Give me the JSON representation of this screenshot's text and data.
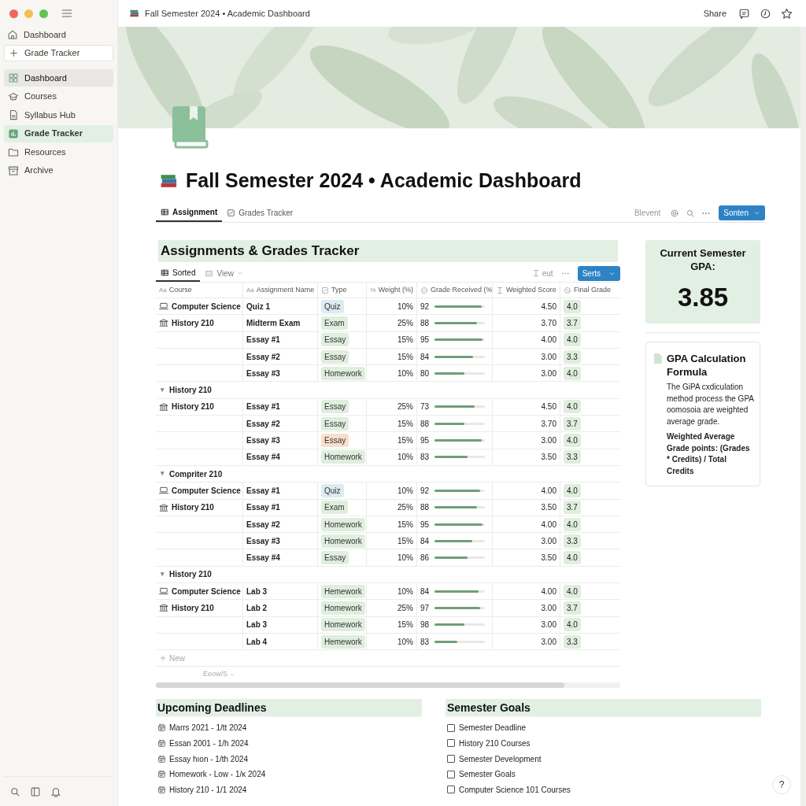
{
  "sidebar": {
    "top_items": [
      {
        "label": "Dashboard"
      }
    ],
    "new_button": {
      "label": "Grade Tracker"
    },
    "nav": [
      {
        "label": "Dashboard",
        "selected": false,
        "hovered": true
      },
      {
        "label": "Courses",
        "selected": false,
        "hovered": false
      },
      {
        "label": "Syllabus Hub",
        "selected": false,
        "hovered": false
      },
      {
        "label": "Grade Tracker",
        "selected": true,
        "hovered": false
      },
      {
        "label": "Resources",
        "selected": false,
        "hovered": false
      },
      {
        "label": "Archive",
        "selected": false,
        "hovered": false
      }
    ]
  },
  "topbar": {
    "title": "Fall Semester 2024 • Academic Dashboard",
    "share": "Share"
  },
  "page": {
    "title": "Fall Semester 2024 • Academic Dashboard",
    "tabs": [
      {
        "label": "Assignment",
        "selected": true
      },
      {
        "label": "Grades Tracker",
        "selected": false
      }
    ],
    "toolbar": {
      "label": "Blevent",
      "button": "Sonten"
    }
  },
  "table": {
    "title": "Assignments & Grades Tracker",
    "views": [
      {
        "label": "Sorted",
        "selected": true
      },
      {
        "label": "View",
        "selected": false
      }
    ],
    "toolbar": {
      "label": "eut",
      "button": "Serts"
    },
    "columns": [
      {
        "label": "Course",
        "prefix": "Aa"
      },
      {
        "label": "Assignment Name",
        "prefix": "Aa"
      },
      {
        "label": "Type"
      },
      {
        "label": "Weight (%)",
        "prefix": "%"
      },
      {
        "label": "Grade Received (%"
      },
      {
        "label": "Weighted Score"
      },
      {
        "label": "Final Grade"
      }
    ],
    "rows": [
      {
        "kind": "row",
        "course": "Computer Science",
        "name": "Quiz 1",
        "type": {
          "label": "Quiz",
          "color": "#dcebf1"
        },
        "weight": "10%",
        "grade": "92",
        "level": 0.93,
        "score": "4.50",
        "final": "4.0"
      },
      {
        "kind": "row",
        "course": "History 210",
        "name": "Midterm Exam",
        "type": {
          "label": "Exam",
          "color": "#dfeedd"
        },
        "weight": "25%",
        "grade": "88",
        "level": 0.85,
        "score": "3.70",
        "final": "3.7"
      },
      {
        "kind": "row",
        "name": "Essay #1",
        "type": {
          "label": "Essay",
          "color": "#dfeedd"
        },
        "weight": "15%",
        "grade": "95",
        "level": 0.96,
        "score": "4.00",
        "final": "4.0"
      },
      {
        "kind": "row",
        "name": "Essay #2",
        "type": {
          "label": "Essay",
          "color": "#dfeedd"
        },
        "weight": "15%",
        "grade": "84",
        "level": 0.76,
        "score": "3.00",
        "final": "3.3"
      },
      {
        "kind": "row",
        "name": "Essay #3",
        "type": {
          "label": "Homework",
          "color": "#dfeedd"
        },
        "weight": "10%",
        "grade": "80",
        "level": 0.6,
        "score": "3.00",
        "final": "4.0"
      },
      {
        "kind": "group",
        "toggle": "▾",
        "label": "History 210"
      },
      {
        "kind": "row",
        "course": "History 210",
        "name": "Essay #1",
        "type": {
          "label": "Essay",
          "color": "#dfeedd"
        },
        "weight": "25%",
        "grade": "73",
        "level": 0.8,
        "score": "4.50",
        "final": "4.0"
      },
      {
        "kind": "row",
        "name": "Essay #2",
        "type": {
          "label": "Essay",
          "color": "#dfeedd"
        },
        "weight": "15%",
        "grade": "88",
        "level": 0.6,
        "score": "3.70",
        "final": "3.7"
      },
      {
        "kind": "row",
        "name": "Essay #3",
        "type": {
          "label": "Essay",
          "color": "#f8dfcc"
        },
        "weight": "15%",
        "grade": "95",
        "level": 0.94,
        "score": "3.00",
        "final": "4.0"
      },
      {
        "kind": "row",
        "name": "Essay #4",
        "type": {
          "label": "Homework",
          "color": "#dfeedd"
        },
        "weight": "10%",
        "grade": "83",
        "level": 0.65,
        "score": "3.50",
        "final": "3.3"
      },
      {
        "kind": "group",
        "toggle": "▾",
        "label": "Compriter 210"
      },
      {
        "kind": "row",
        "course": "Computer Science",
        "name": "Essay #1",
        "type": {
          "label": "Quiz",
          "color": "#dcebf1"
        },
        "weight": "10%",
        "grade": "92",
        "level": 0.9,
        "score": "4.00",
        "final": "4.0"
      },
      {
        "kind": "row",
        "course": "History 210",
        "name": "Essay #1",
        "type": {
          "label": "Exam",
          "color": "#dfeedd"
        },
        "weight": "25%",
        "grade": "88",
        "level": 0.85,
        "score": "3.50",
        "final": "3.7"
      },
      {
        "kind": "row",
        "name": "Essay #2",
        "type": {
          "label": "Homework",
          "color": "#dfeedd"
        },
        "weight": "15%",
        "grade": "95",
        "level": 0.95,
        "score": "4.00",
        "final": "4.0"
      },
      {
        "kind": "row",
        "name": "Essay #3",
        "type": {
          "label": "Homework",
          "color": "#dfeedd"
        },
        "weight": "15%",
        "grade": "84",
        "level": 0.75,
        "score": "3.00",
        "final": "3.3"
      },
      {
        "kind": "row",
        "name": "Essay #4",
        "type": {
          "label": "Essay",
          "color": "#dfeedd"
        },
        "weight": "10%",
        "grade": "86",
        "level": 0.66,
        "score": "3.50",
        "final": "4.0"
      },
      {
        "kind": "group",
        "toggle": "▾",
        "label": "History 210"
      },
      {
        "kind": "row",
        "course": "Computer Science",
        "name": "Lab 3",
        "type": {
          "label": "Hemework",
          "color": "#dfeedd"
        },
        "weight": "10%",
        "grade": "84",
        "level": 0.88,
        "score": "4.00",
        "final": "4.0"
      },
      {
        "kind": "row",
        "course": "History 210",
        "name": "Lab 2",
        "type": {
          "label": "Homework",
          "color": "#dfeedd"
        },
        "weight": "25%",
        "grade": "97",
        "level": 0.9,
        "score": "3.00",
        "final": "3.7"
      },
      {
        "kind": "row",
        "name": "Lab 3",
        "type": {
          "label": "Homework",
          "color": "#dfeedd"
        },
        "weight": "15%",
        "grade": "98",
        "level": 0.6,
        "score": "3.00",
        "final": "4.0"
      },
      {
        "kind": "row",
        "name": "Lab 4",
        "type": {
          "label": "Hemework",
          "color": "#dfeedd"
        },
        "weight": "10%",
        "grade": "83",
        "level": 0.45,
        "score": "3.00",
        "final": "3.3"
      }
    ],
    "new_row": "New",
    "footer": "Eeow/S"
  },
  "gpa_card": {
    "label": "Current Semester GPA:",
    "value": "3.85"
  },
  "formula_card": {
    "title": "GPA Calculation Formula",
    "text": "The GiPA cxdiculation method process the GPA oomosoia are weighted average grade.",
    "formula": "Weighted Average Grade points: (Grades * Credits) / Total Credits"
  },
  "deadlines": {
    "title": "Upcoming Deadlines",
    "items": [
      "Marrs 2021 - 1/tt 2024",
      "Essan 2001 - 1/h 2024",
      "Essay hıon - 1/th 2024",
      "Homework - Low - 1/ĸ 2024",
      "History 210 - 1/1 2024"
    ]
  },
  "goals": {
    "title": "Semester Goals",
    "items": [
      {
        "label": "Semester Deadline",
        "checked": false
      },
      {
        "label": "History 210 Courses",
        "checked": false
      },
      {
        "label": "Semester Development",
        "checked": false
      },
      {
        "label": "Semester Goals",
        "checked": false
      },
      {
        "label": "Computer Science 101 Courses",
        "checked": false
      }
    ]
  },
  "help": "?"
}
